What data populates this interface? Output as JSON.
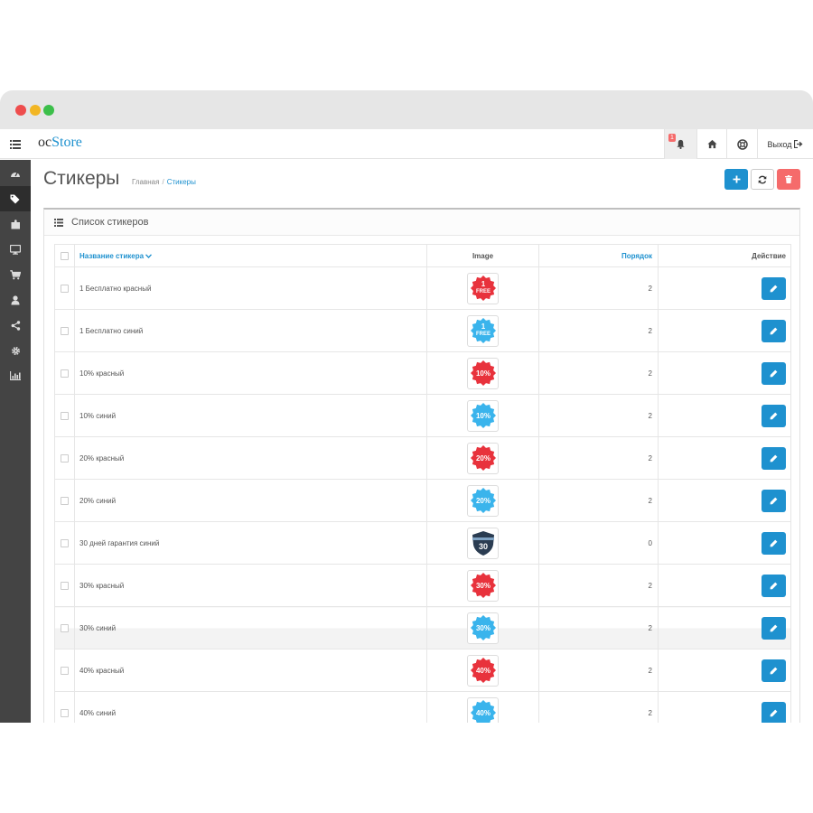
{
  "app": {
    "logo_prefix": "oc",
    "logo_brand": "Store",
    "notification_count": "1",
    "logout_label": "Выход"
  },
  "page": {
    "title": "Стикеры",
    "breadcrumb": [
      "Главная",
      "Стикеры"
    ]
  },
  "panel": {
    "title": "Список стикеров"
  },
  "table": {
    "headers": {
      "name": "Название стикера",
      "image": "Image",
      "order": "Порядок",
      "action": "Действие"
    },
    "rows": [
      {
        "name": "1 Бесплатно красный",
        "order": "2",
        "badge_text": "1 FREE",
        "badge_color": "#e8323c",
        "badge_shape": "starburst"
      },
      {
        "name": "1 Бесплатно синий",
        "order": "2",
        "badge_text": "1 FREE",
        "badge_color": "#3ab4ec",
        "badge_shape": "starburst"
      },
      {
        "name": "10% красный",
        "order": "2",
        "badge_text": "10%",
        "badge_color": "#e8323c",
        "badge_shape": "starburst"
      },
      {
        "name": "10% синий",
        "order": "2",
        "badge_text": "10%",
        "badge_color": "#3ab4ec",
        "badge_shape": "starburst"
      },
      {
        "name": "20% красный",
        "order": "2",
        "badge_text": "20%",
        "badge_color": "#e8323c",
        "badge_shape": "starburst"
      },
      {
        "name": "20% синий",
        "order": "2",
        "badge_text": "20%",
        "badge_color": "#3ab4ec",
        "badge_shape": "starburst"
      },
      {
        "name": "30 дней гарантия синий",
        "order": "0",
        "badge_text": "30",
        "badge_color": "#2b3d52",
        "badge_shape": "shield"
      },
      {
        "name": "30% красный",
        "order": "2",
        "badge_text": "30%",
        "badge_color": "#e8323c",
        "badge_shape": "starburst"
      },
      {
        "name": "30% синий",
        "order": "2",
        "badge_text": "30%",
        "badge_color": "#3ab4ec",
        "badge_shape": "starburst"
      },
      {
        "name": "40% красный",
        "order": "2",
        "badge_text": "40%",
        "badge_color": "#e8323c",
        "badge_shape": "starburst"
      },
      {
        "name": "40% синий",
        "order": "2",
        "badge_text": "40%",
        "badge_color": "#3ab4ec",
        "badge_shape": "starburst"
      }
    ]
  },
  "colors": {
    "primary": "#1e91cf",
    "danger": "#f56b6b",
    "sidebar": "#444444"
  }
}
